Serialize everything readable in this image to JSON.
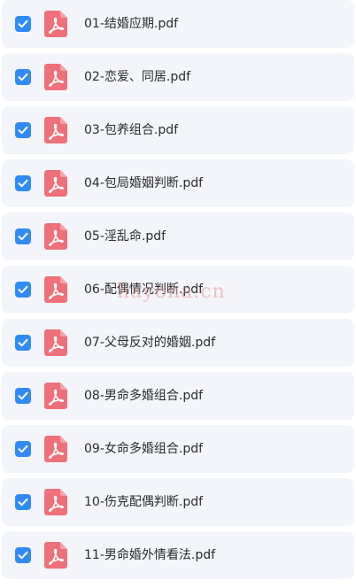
{
  "colors": {
    "row_background": "#f4f5fa",
    "checkbox": "#2f8cf7",
    "pdf_icon": "#f0707a",
    "text": "#2b2b2b"
  },
  "watermark": {
    "text": "hayona.cn"
  },
  "files": [
    {
      "name": "01-结婚应期.pdf",
      "checked": true,
      "icon": "pdf-icon"
    },
    {
      "name": "02-恋爱、同居.pdf",
      "checked": true,
      "icon": "pdf-icon"
    },
    {
      "name": "03-包养组合.pdf",
      "checked": true,
      "icon": "pdf-icon"
    },
    {
      "name": "04-包局婚姻判断.pdf",
      "checked": true,
      "icon": "pdf-icon"
    },
    {
      "name": "05-淫乱命.pdf",
      "checked": true,
      "icon": "pdf-icon"
    },
    {
      "name": "06-配偶情况判断.pdf",
      "checked": true,
      "icon": "pdf-icon"
    },
    {
      "name": "07-父母反对的婚姻.pdf",
      "checked": true,
      "icon": "pdf-icon"
    },
    {
      "name": "08-男命多婚组合.pdf",
      "checked": true,
      "icon": "pdf-icon"
    },
    {
      "name": "09-女命多婚组合.pdf",
      "checked": true,
      "icon": "pdf-icon"
    },
    {
      "name": "10-伤克配偶判断.pdf",
      "checked": true,
      "icon": "pdf-icon"
    },
    {
      "name": "11-男命婚外情看法.pdf",
      "checked": true,
      "icon": "pdf-icon"
    }
  ]
}
